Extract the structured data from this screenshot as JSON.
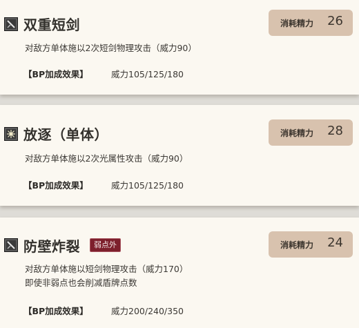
{
  "skills": [
    {
      "icon": "sword-icon",
      "name": "双重短剑",
      "badge": "",
      "cost_label": "消耗精力",
      "cost": "26",
      "description": [
        "对敌方单体施以2次短剑物理攻击（威力90）"
      ],
      "bp_label": "【BP加成效果】",
      "bp_value": "威力105/125/180"
    },
    {
      "icon": "light-burst-icon",
      "name": "放逐（单体）",
      "badge": "",
      "cost_label": "消耗精力",
      "cost": "28",
      "description": [
        "对敌方单体施以2次光属性攻击（威力90）"
      ],
      "bp_label": "【BP加成效果】",
      "bp_value": "威力105/125/180"
    },
    {
      "icon": "sword-icon",
      "name": "防壁炸裂",
      "badge": "弱点外",
      "cost_label": "消耗精力",
      "cost": "24",
      "description": [
        "对敌方单体施以短剑物理攻击（威力170）",
        "即使非弱点也会削减盾牌点数"
      ],
      "bp_label": "【BP加成效果】",
      "bp_value": "威力200/240/350"
    }
  ],
  "colors": {
    "card_background": "#fbf8f1",
    "page_background": "#dedcd7",
    "cost_box": "#d8c2ae",
    "weak_badge": "#7d1f2c",
    "text": "#3b3834"
  }
}
